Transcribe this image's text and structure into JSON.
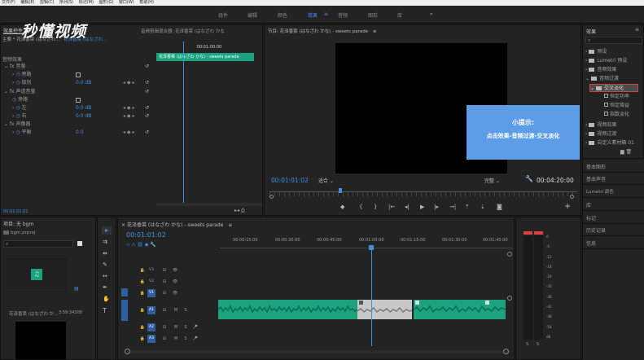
{
  "menubar": [
    "文件(F)",
    "编辑(E)",
    "剪辑(C)",
    "序列(S)",
    "标记(M)",
    "图形(G)",
    "窗口(W)",
    "帮助(H)"
  ],
  "workspaces": [
    "组件",
    "编辑",
    "颜色",
    "效果",
    "音频",
    "图形",
    "库"
  ],
  "workspace_active": "效果",
  "watermark": "秒懂视频",
  "effect_controls": {
    "tab": "效果控件",
    "tab2": "音频剪辑混合器: 花泽香菜 (はなざわ かな",
    "master": "主要 * 花泽香菜 (はなざわ...",
    "clip": "花泽香菜 (はなざわ...",
    "clip_bar": "花泽香菜 (はなざわ かな) - sweets parade",
    "section": "音频效果",
    "rows": [
      {
        "label": "fx 音量",
        "value": ""
      },
      {
        "label": "旁路",
        "value": ""
      },
      {
        "label": "级别",
        "value": "0.0 dB"
      },
      {
        "label": "fx 声道音量",
        "value": ""
      },
      {
        "label": "旁路",
        "value": ""
      },
      {
        "label": "左",
        "value": "0.0 dB"
      },
      {
        "label": "右",
        "value": "0.0 dB"
      },
      {
        "label": "fx 声像器",
        "value": ""
      },
      {
        "label": "平衡",
        "value": "0.0"
      }
    ],
    "timecode": "00:01:01:02",
    "ruler_time": "00:01:00:00"
  },
  "program": {
    "title": "节目: 花泽香菜 (はなざわ かな) - sweets parade",
    "timecode": "00:01:01:02",
    "fit": "适合",
    "quality": "完整",
    "duration": "00:04:20:00"
  },
  "tooltip": {
    "title": "小提示:",
    "text": "点击效果-音频过渡-交叉淡化"
  },
  "effects_panel": {
    "title": "效果",
    "items": [
      {
        "label": "预设",
        "indent": 0,
        "kind": "folder"
      },
      {
        "label": "Lumetri 预设",
        "indent": 0,
        "kind": "folder"
      },
      {
        "label": "音频效果",
        "indent": 0,
        "kind": "folder"
      },
      {
        "label": "音频过渡",
        "indent": 0,
        "kind": "folder"
      },
      {
        "label": "交叉淡化",
        "indent": 1,
        "kind": "folder-selected"
      },
      {
        "label": "恒定功率",
        "indent": 2,
        "kind": "effect"
      },
      {
        "label": "恒定增益",
        "indent": 2,
        "kind": "effect"
      },
      {
        "label": "指数淡化",
        "indent": 2,
        "kind": "effect"
      },
      {
        "label": "视频效果",
        "indent": 0,
        "kind": "folder"
      },
      {
        "label": "视频过渡",
        "indent": 0,
        "kind": "folder"
      },
      {
        "label": "自定义素材箱 01",
        "indent": 0,
        "kind": "folder"
      }
    ],
    "side": [
      "基本图形",
      "基本声音",
      "Lumetri 颜色",
      "库",
      "标记",
      "历史记录",
      "信息"
    ]
  },
  "project": {
    "title": "项目: 无 bgm",
    "file": "bgm.prproj",
    "item_name": "花泽香菜 (はなざわ か...",
    "item_duration": "3:59:34308"
  },
  "timeline": {
    "title": "花泽香菜 (はなざわ かな) - sweets parade",
    "timecode": "00:01:01:02",
    "ruler": [
      "00:00:15:00",
      "00:00:30:00",
      "00:00:45:00",
      "00:01:00:00",
      "00:01:15:00",
      "00:01:30:00",
      "00:01:45:00"
    ],
    "video_tracks": [
      "V3",
      "V2",
      "V1"
    ],
    "audio_tracks": [
      "A1",
      "A2",
      "A3"
    ]
  },
  "meter": {
    "scale": [
      "0",
      "-6",
      "-12",
      "-18",
      "-24",
      "-30",
      "-36",
      "-42",
      "-48",
      "-54",
      "dB"
    ],
    "bottom": [
      "S",
      "S"
    ]
  }
}
